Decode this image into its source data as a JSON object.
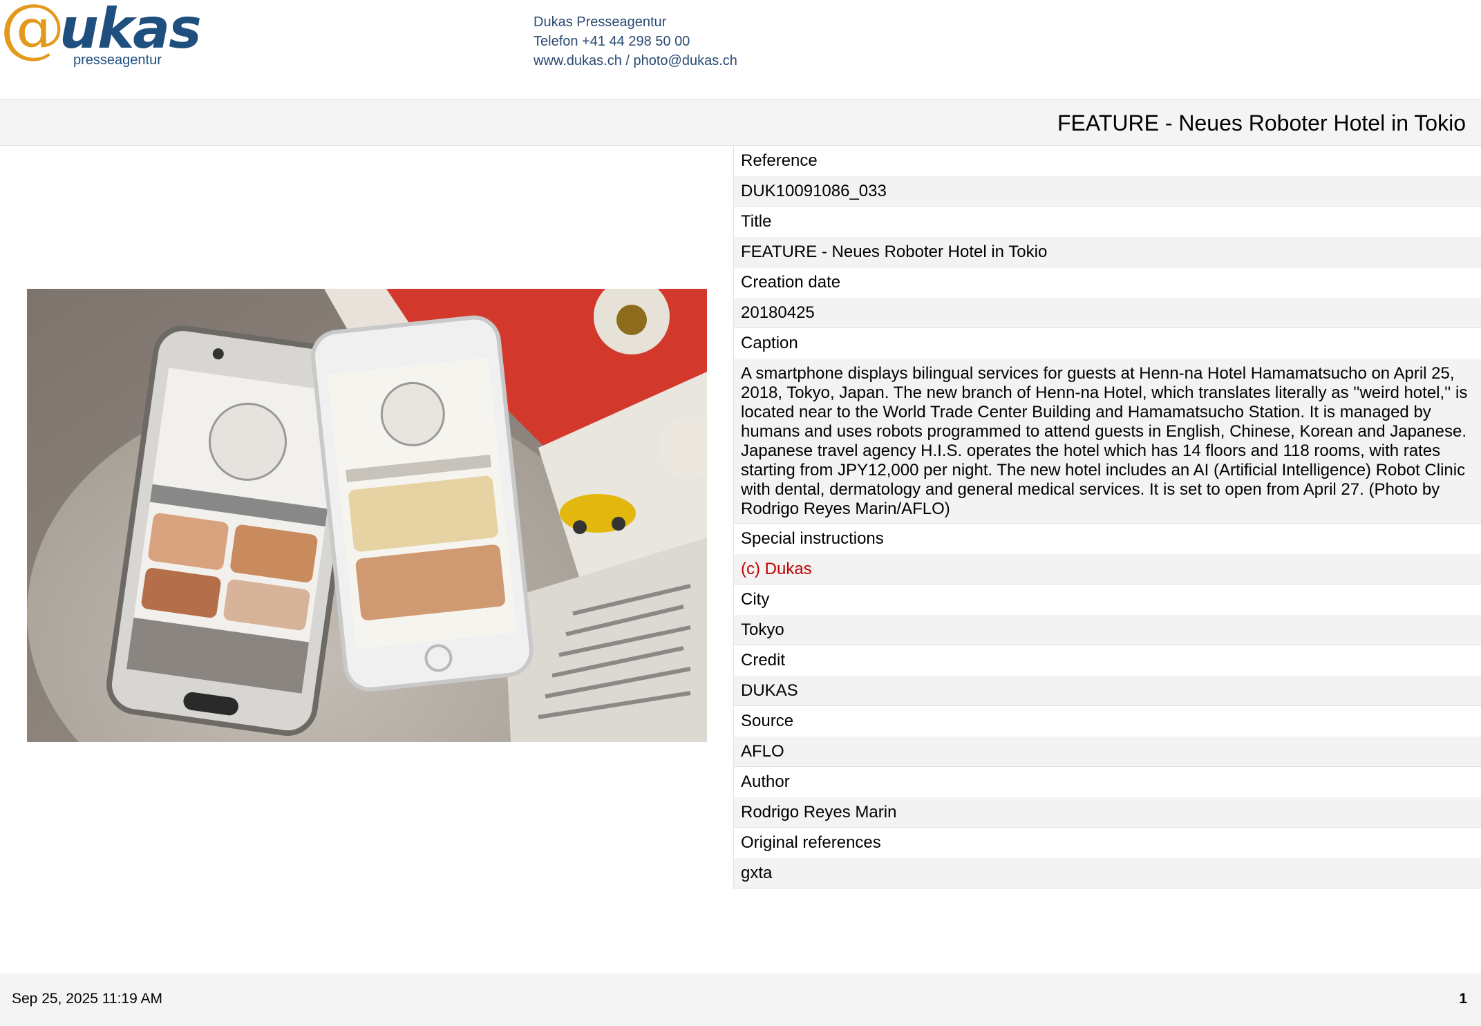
{
  "header": {
    "logo_mark": "@",
    "logo_word": "ukas",
    "logo_sub": "presseagentur",
    "contact_lines": [
      "Dukas Presseagentur",
      "Telefon  +41 44 298 50 00",
      "www.dukas.ch  /  photo@dukas.ch"
    ]
  },
  "title": "FEATURE - Neues Roboter Hotel in Tokio",
  "fields": [
    {
      "label": "Reference",
      "value": "DUK10091086_033"
    },
    {
      "label": "Title",
      "value": "FEATURE - Neues Roboter Hotel in Tokio"
    },
    {
      "label": "Creation date",
      "value": "20180425"
    },
    {
      "label": "Caption",
      "value": "A smartphone displays bilingual services for guests at Henn-na Hotel Hamamatsucho on April 25, 2018, Tokyo, Japan. The new branch of Henn-na Hotel, which translates literally as ''weird hotel,'' is located near to the World Trade Center Building and Hamamatsucho Station. It is managed by humans and uses robots programmed to attend guests in English, Chinese, Korean and Japanese. Japanese travel agency H.I.S. operates the hotel which has 14 floors and 118 rooms, with rates starting from JPY12,000 per night. The new hotel includes an AI (Artificial Intelligence) Robot Clinic with dental, dermatology and general medical services. It is set to open from April 27. (Photo by Rodrigo Reyes Marin/AFLO)"
    },
    {
      "label": "Special instructions",
      "value": "(c) Dukas"
    },
    {
      "label": "City",
      "value": "Tokyo"
    },
    {
      "label": "Credit",
      "value": "DUKAS"
    },
    {
      "label": "Source",
      "value": "AFLO"
    },
    {
      "label": "Author",
      "value": "Rodrigo Reyes Marin"
    },
    {
      "label": "Original references",
      "value": "gxta"
    }
  ],
  "footer": {
    "date": "Sep 25, 2025 11:19 AM",
    "page_number": "1"
  },
  "colors": {
    "logo_orange": "#e39a1c",
    "logo_blue": "#1f4f7e",
    "special_instructions_red": "#c00000"
  }
}
